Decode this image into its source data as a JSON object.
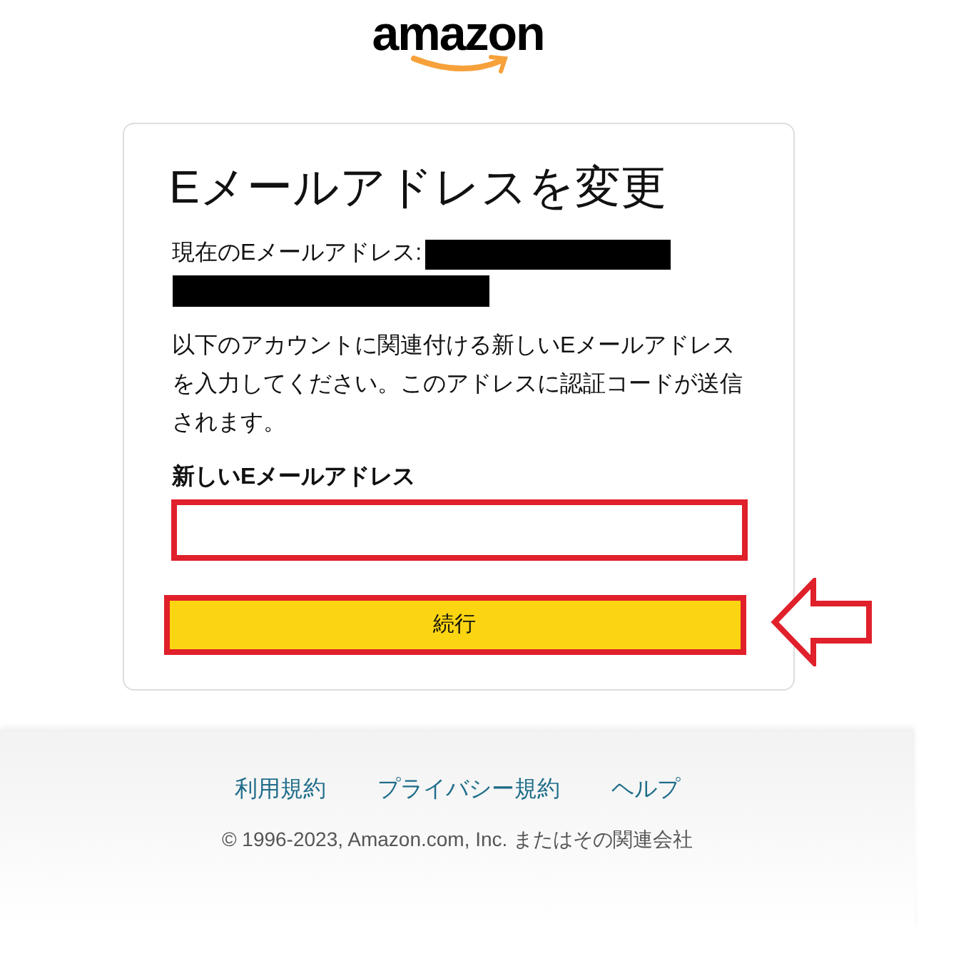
{
  "logo": {
    "text": "amazon"
  },
  "card": {
    "title": "Eメールアドレスを変更",
    "current_email_label": "現在のEメールアドレス:",
    "description": "以下のアカウントに関連付ける新しいEメールアドレスを入力してください。このアドレスに認証コードが送信されます。",
    "field": {
      "label": "新しいEメールアドレス",
      "highlighted": true
    },
    "button": {
      "label": "続行",
      "highlighted": true
    }
  },
  "footer": {
    "links": [
      "利用規約",
      "プライバシー規約",
      "ヘルプ"
    ],
    "copyright": "© 1996-2023, Amazon.com, Inc. またはその関連会社"
  }
}
